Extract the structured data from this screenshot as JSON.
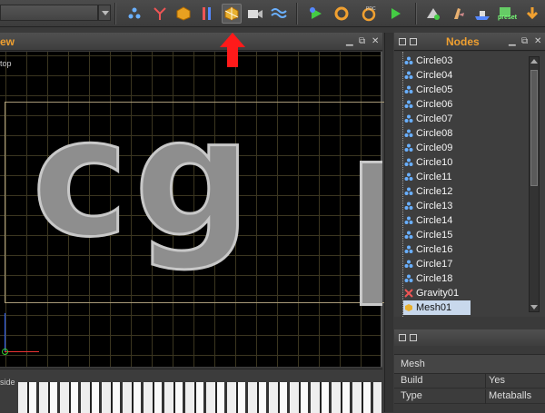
{
  "viewport": {
    "title_fragment": "ew",
    "view_label": "top",
    "cg_text": "cg",
    "bottom_label": "side"
  },
  "nodes_panel": {
    "title": "Nodes",
    "items": [
      {
        "label": "Circle03",
        "icon": "particle-icon"
      },
      {
        "label": "Circle04",
        "icon": "particle-icon"
      },
      {
        "label": "Circle05",
        "icon": "particle-icon"
      },
      {
        "label": "Circle06",
        "icon": "particle-icon"
      },
      {
        "label": "Circle07",
        "icon": "particle-icon"
      },
      {
        "label": "Circle08",
        "icon": "particle-icon"
      },
      {
        "label": "Circle09",
        "icon": "particle-icon"
      },
      {
        "label": "Circle10",
        "icon": "particle-icon"
      },
      {
        "label": "Circle11",
        "icon": "particle-icon"
      },
      {
        "label": "Circle12",
        "icon": "particle-icon"
      },
      {
        "label": "Circle13",
        "icon": "particle-icon"
      },
      {
        "label": "Circle14",
        "icon": "particle-icon"
      },
      {
        "label": "Circle15",
        "icon": "particle-icon"
      },
      {
        "label": "Circle16",
        "icon": "particle-icon"
      },
      {
        "label": "Circle17",
        "icon": "particle-icon"
      },
      {
        "label": "Circle18",
        "icon": "particle-icon"
      },
      {
        "label": "Gravity01",
        "icon": "gravity-icon"
      },
      {
        "label": "Mesh01",
        "icon": "mesh-icon",
        "selected": true
      }
    ]
  },
  "properties": {
    "title": "Mesh",
    "rows": [
      {
        "name": "Build",
        "value": "Yes"
      },
      {
        "name": "Type",
        "value": "Metaballs"
      }
    ]
  },
  "toolbar": {
    "preset_label": "preset",
    "tools": [
      "particle-group-icon",
      "split-icon",
      "cube-icon",
      "slider-icon",
      "mesher-icon",
      "camera-icon",
      "wave-icon",
      "simulate-icon",
      "reset-icon",
      "pdc-icon",
      "play-icon",
      "export-icon",
      "hand-icon",
      "ship-icon",
      "preset-icon",
      "download-icon"
    ]
  },
  "colors": {
    "accent": "#f0a030",
    "highlight_arrow": "#ff1a1a",
    "selection": "#c8d8ec",
    "grid": "#3b3620"
  }
}
